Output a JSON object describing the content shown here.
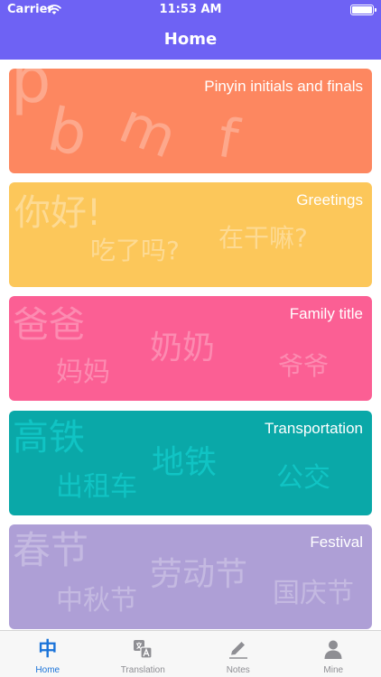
{
  "status_bar": {
    "carrier": "Carrier",
    "time": "11:53 AM"
  },
  "nav": {
    "title": "Home"
  },
  "colors": {
    "accent": "#6e62f4",
    "tab_active": "#1a73d9"
  },
  "cards": [
    {
      "title": "Pinyin initials and finals",
      "color": "#fd8760",
      "decor": [
        "p",
        "b",
        "m",
        "f"
      ]
    },
    {
      "title": "Greetings",
      "color": "#fcc75a",
      "decor": [
        "你好!",
        "吃了吗?",
        "在干嘛?"
      ]
    },
    {
      "title": "Family title",
      "color": "#fb5f94",
      "decor": [
        "爸爸",
        "奶奶",
        "妈妈",
        "爷爷"
      ]
    },
    {
      "title": "Transportation",
      "color": "#0aa8a8",
      "decor": [
        "高铁",
        "地铁",
        "出租车",
        "公交"
      ]
    },
    {
      "title": "Festival",
      "color": "#ae9fd6",
      "decor": [
        "春节",
        "劳动节",
        "中秋节",
        "国庆节"
      ]
    }
  ],
  "tabs": [
    {
      "label": "Home",
      "icon": "home-zhong-icon",
      "glyph": "中",
      "active": true
    },
    {
      "label": "Translation",
      "icon": "translation-icon",
      "active": false
    },
    {
      "label": "Notes",
      "icon": "pencil-icon",
      "active": false
    },
    {
      "label": "Mine",
      "icon": "person-icon",
      "active": false
    }
  ]
}
